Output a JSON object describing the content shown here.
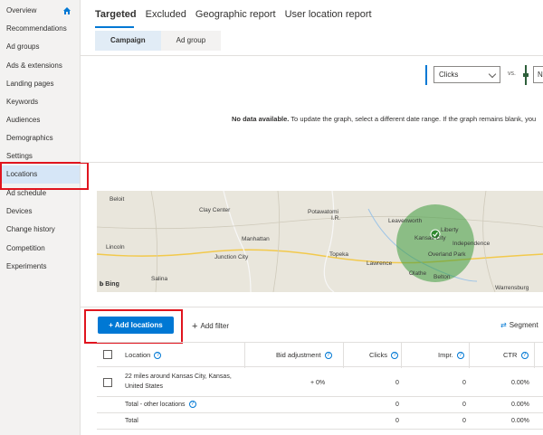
{
  "sidebar": {
    "items": [
      {
        "label": "Overview"
      },
      {
        "label": "Recommendations"
      },
      {
        "label": "Ad groups"
      },
      {
        "label": "Ads & extensions"
      },
      {
        "label": "Landing pages"
      },
      {
        "label": "Keywords"
      },
      {
        "label": "Audiences"
      },
      {
        "label": "Demographics"
      },
      {
        "label": "Settings"
      },
      {
        "label": "Locations"
      },
      {
        "label": "Ad schedule"
      },
      {
        "label": "Devices"
      },
      {
        "label": "Change history"
      },
      {
        "label": "Competition"
      },
      {
        "label": "Experiments"
      }
    ],
    "active": "Locations",
    "home_icon": "home-icon"
  },
  "tabs": [
    {
      "label": "Targeted"
    },
    {
      "label": "Excluded"
    },
    {
      "label": "Geographic report"
    },
    {
      "label": "User location report"
    }
  ],
  "subtabs": [
    {
      "label": "Campaign"
    },
    {
      "label": "Ad group"
    }
  ],
  "chart": {
    "metric1": "Clicks",
    "vs": "vs.",
    "metric2": "N",
    "nodata_bold": "No data available.",
    "nodata_rest": " To update the graph, select a different date range. If the graph remains blank, you"
  },
  "map": {
    "labels": [
      "Beloit",
      "Clay Center",
      "Potawatomi",
      "I.R.",
      "Leavenworth",
      "Liberty",
      "Manhattan",
      "Kansas City",
      "Independence",
      "Lincoln",
      "Junction City",
      "Topeka",
      "Lawrence",
      "Overland Park",
      "Olathe",
      "Belton",
      "Salina",
      "Warrensburg"
    ],
    "brand": "Bing",
    "accent": "#3e9a3e"
  },
  "actions": {
    "add_locations": "+ Add locations",
    "add_filter": "Add filter",
    "segment": "Segment"
  },
  "table": {
    "headers": [
      "Location",
      "Bid adjustment",
      "Clicks",
      "Impr.",
      "CTR"
    ],
    "rows": [
      {
        "location": "22 miles around Kansas City, Kansas,",
        "location2": "United States",
        "bid": "+ 0%",
        "clicks": "0",
        "impr": "0",
        "ctr": "0.00%"
      },
      {
        "location": "Total - other locations",
        "location2": "",
        "bid": "",
        "clicks": "0",
        "impr": "0",
        "ctr": "0.00%"
      },
      {
        "location": "Total",
        "location2": "",
        "bid": "",
        "clicks": "0",
        "impr": "0",
        "ctr": "0.00%"
      }
    ]
  }
}
